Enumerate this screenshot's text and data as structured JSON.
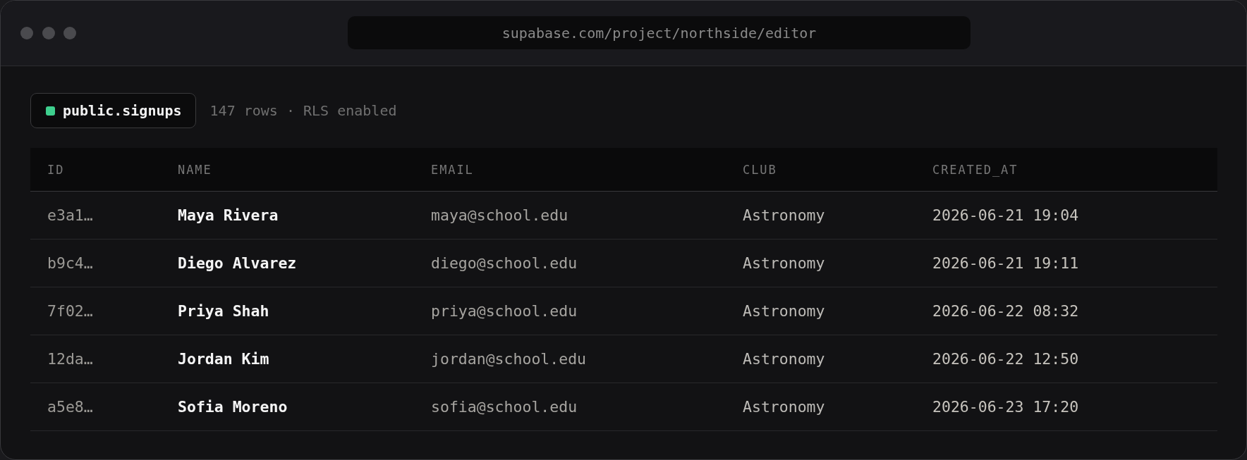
{
  "window": {
    "address": "supabase.com/project/northside/editor"
  },
  "table_badge": {
    "name": "public.signups"
  },
  "meta": "147 rows · RLS enabled",
  "table": {
    "columns": [
      "ID",
      "NAME",
      "EMAIL",
      "CLUB",
      "CREATED_AT"
    ],
    "rows": [
      [
        "e3a1…",
        "Maya Rivera",
        "maya@school.edu",
        "Astronomy",
        "2026-06-21 19:04"
      ],
      [
        "b9c4…",
        "Diego Alvarez",
        "diego@school.edu",
        "Astronomy",
        "2026-06-21 19:11"
      ],
      [
        "7f02…",
        "Priya Shah",
        "priya@school.edu",
        "Astronomy",
        "2026-06-22 08:32"
      ],
      [
        "12da…",
        "Jordan Kim",
        "jordan@school.edu",
        "Astronomy",
        "2026-06-22 12:50"
      ],
      [
        "a5e8…",
        "Sofia Moreno",
        "sofia@school.edu",
        "Astronomy",
        "2026-06-23 17:20"
      ]
    ]
  }
}
